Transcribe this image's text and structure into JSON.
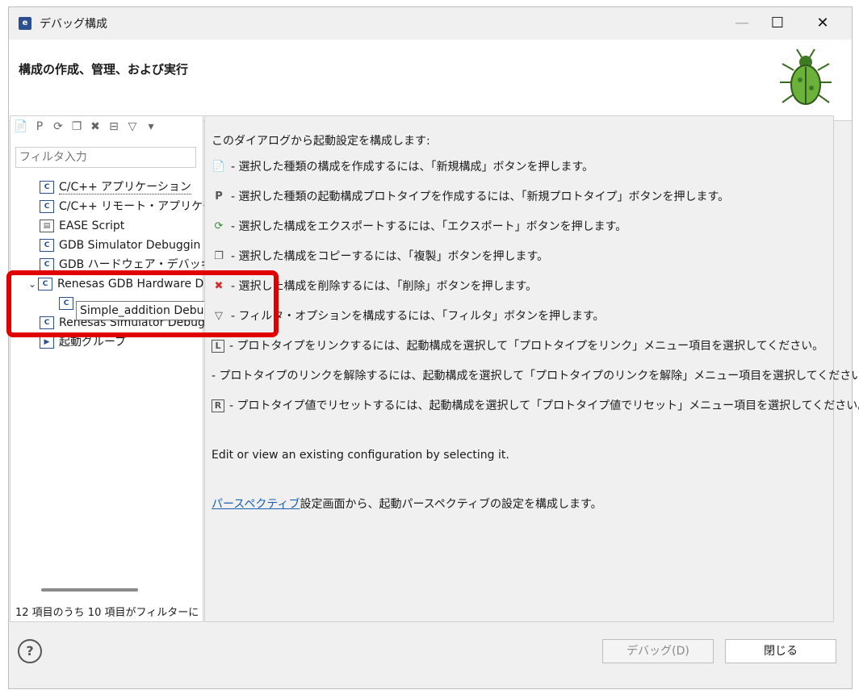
{
  "window": {
    "title": "デバッグ構成",
    "minimize_symbol": "—",
    "maximize_symbol": "☐",
    "close_symbol": "✕"
  },
  "header": {
    "title": "構成の作成、管理、および実行"
  },
  "left": {
    "toolbar": [
      {
        "icon": "new-config-icon",
        "glyph": "📄"
      },
      {
        "icon": "new-prototype-icon",
        "glyph": "P"
      },
      {
        "icon": "export-icon",
        "glyph": "⟳"
      },
      {
        "icon": "duplicate-icon",
        "glyph": "❐"
      },
      {
        "icon": "delete-icon",
        "glyph": "✖"
      },
      {
        "icon": "collapse-all-icon",
        "glyph": "⊟"
      },
      {
        "icon": "filter-icon",
        "glyph": "▽"
      },
      {
        "icon": "dropdown-icon",
        "glyph": "▾"
      }
    ],
    "filter_placeholder": "フィルタ入力",
    "tree": [
      {
        "label": "C/C++ アプリケーション",
        "icon": "c-app-icon",
        "glyph": "C"
      },
      {
        "label": "C/C++ リモート・アプリケーシ",
        "icon": "c-remote-icon",
        "glyph": "C"
      },
      {
        "label": "EASE Script",
        "icon": "ease-script-icon",
        "glyph": "▤"
      },
      {
        "label": "GDB Simulator Debuggin",
        "icon": "gdb-sim-icon",
        "glyph": "C"
      },
      {
        "label": "GDB ハードウェア・デバッギング",
        "icon": "gdb-hw-icon",
        "glyph": "C"
      },
      {
        "label": "Renesas GDB Hardware D",
        "icon": "renesas-hw-icon",
        "glyph": "C"
      },
      {
        "label": "Simple_addition Debug_Flat",
        "icon": "config-icon",
        "glyph": "C"
      },
      {
        "label": "Renesas Simulator Debug",
        "icon": "renesas-sim-icon",
        "glyph": "C"
      },
      {
        "label": "起動グループ",
        "icon": "launch-group-icon",
        "glyph": "▶"
      }
    ],
    "status": "12 項目のうち 10 項目がフィルターに"
  },
  "right": {
    "intro": "このダイアログから起動設定を構成します:",
    "lines": [
      {
        "icon": "new-config-icon",
        "glyph": "📄",
        "text": "- 選択した種類の構成を作成するには、「新規構成」ボタンを押します。"
      },
      {
        "icon": "new-prototype-icon",
        "glyph": "P",
        "text": "- 選択した種類の起動構成プロトタイプを作成するには、「新規プロトタイプ」ボタンを押します。"
      },
      {
        "icon": "export-icon",
        "glyph": "⟳",
        "text": "- 選択した構成をエクスポートするには、「エクスポート」ボタンを押します。"
      },
      {
        "icon": "duplicate-icon",
        "glyph": "❐",
        "text": "- 選択した構成をコピーするには、「複製」ボタンを押します。"
      },
      {
        "icon": "delete-icon",
        "glyph": "✖",
        "text": "- 選択した構成を削除するには、「削除」ボタンを押します。"
      },
      {
        "icon": "filter-icon",
        "glyph": "▽",
        "text": "- フィルタ・オプションを構成するには、「フィルタ」ボタンを押します。"
      },
      {
        "icon": "link-prototype-icon",
        "glyph": "L",
        "text": "- プロトタイプをリンクするには、起動構成を選択して「プロトタイプをリンク」メニュー項目を選択してください。"
      },
      {
        "icon": "",
        "glyph": "",
        "text": "- プロトタイプのリンクを解除するには、起動構成を選択して「プロトタイプのリンクを解除」メニュー項目を選択してください。"
      },
      {
        "icon": "reset-prototype-icon",
        "glyph": "R",
        "text": "- プロトタイプ値でリセットするには、起動構成を選択して「プロトタイプ値でリセット」メニュー項目を選択してください。"
      }
    ],
    "edit_text": "Edit or view an existing configuration by selecting it.",
    "perspective_link": "パースペクティブ",
    "perspective_text": "設定画面から、起動パースペクティブの設定を構成します。"
  },
  "footer": {
    "help_symbol": "?",
    "debug_button": "デバッグ(D)",
    "close_button": "閉じる"
  },
  "colors": {
    "highlight": "#e00000",
    "link": "#1a5fb4",
    "delete_red": "#d32f2f"
  }
}
